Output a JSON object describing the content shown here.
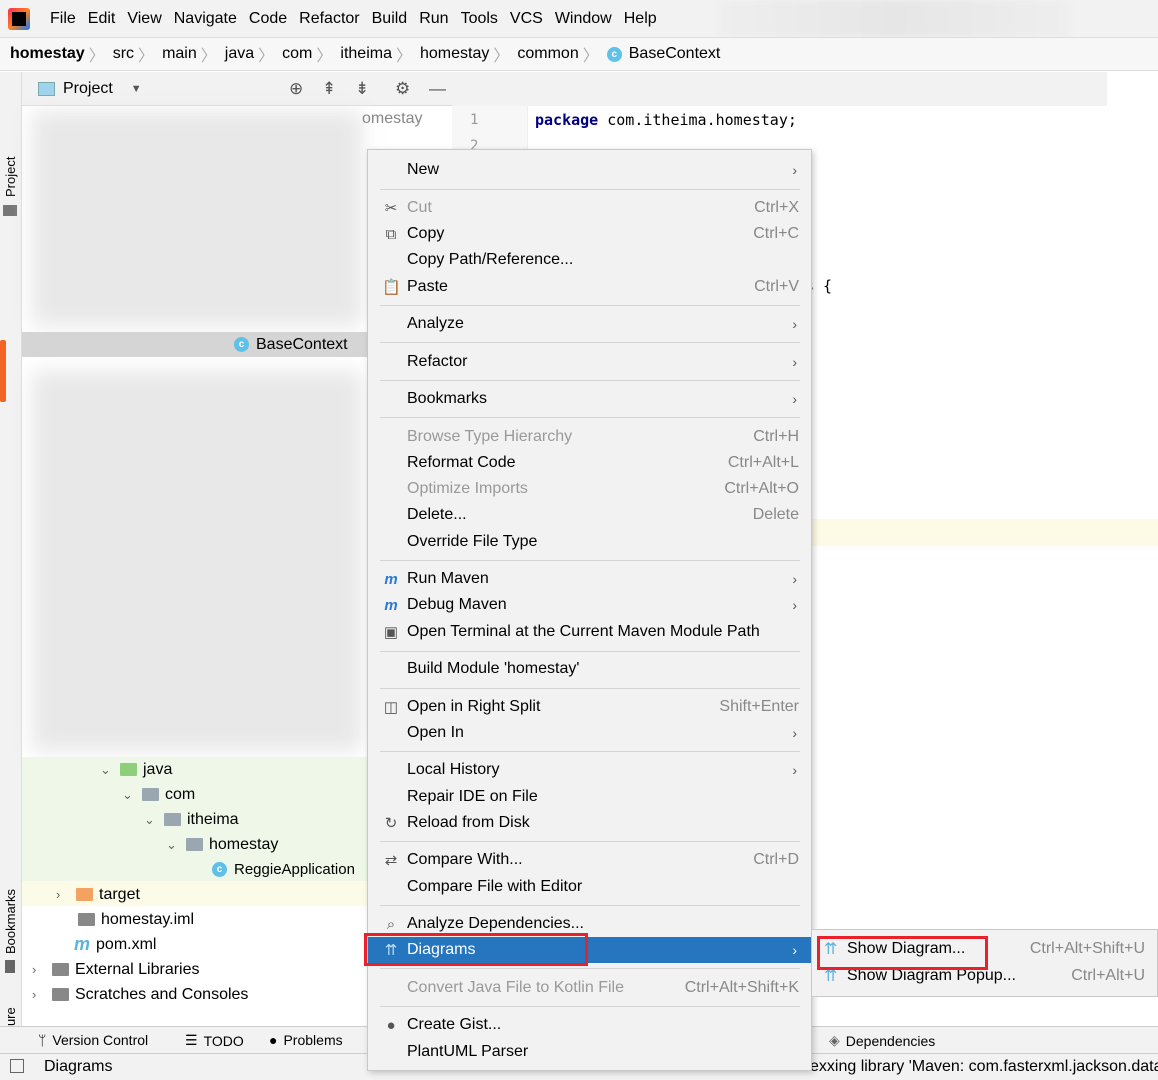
{
  "menubar": {
    "items": [
      "File",
      "Edit",
      "View",
      "Navigate",
      "Code",
      "Refactor",
      "Build",
      "Run",
      "Tools",
      "VCS",
      "Window",
      "Help"
    ]
  },
  "breadcrumb": [
    "homestay",
    "src",
    "main",
    "java",
    "com",
    "itheima",
    "homestay",
    "common",
    "BaseContext"
  ],
  "left_strip": {
    "project": "Project",
    "bookmarks": "Bookmarks",
    "structure": "Structure"
  },
  "project_panel": {
    "title": "Project",
    "partial_label": "omestay"
  },
  "tree": [
    {
      "label": "BaseContext",
      "icon": "class-icon"
    },
    {
      "label": "java",
      "icon": "source-folder-icon"
    },
    {
      "label": "com",
      "icon": "package-icon"
    },
    {
      "label": "itheima",
      "icon": "package-icon"
    },
    {
      "label": "homestay",
      "icon": "package-icon"
    },
    {
      "label": "ReggieApplication",
      "icon": "class-icon"
    },
    {
      "label": "target",
      "icon": "excluded-folder-icon"
    },
    {
      "label": "homestay.iml",
      "icon": "module-file-icon"
    },
    {
      "label": "pom.xml",
      "icon": "maven-icon"
    },
    {
      "label": "External Libraries",
      "icon": "libraries-icon"
    },
    {
      "label": "Scratches and Consoles",
      "icon": "scratches-icon"
    }
  ],
  "editor": {
    "line_numbers": [
      "1",
      "2"
    ],
    "code_keyword": "package",
    "code_rest": " com.itheima.homestay;",
    "brace": "s {"
  },
  "context_menu": [
    {
      "label": "New",
      "submenu": true
    },
    {
      "label": "Cut",
      "shortcut": "Ctrl+X",
      "icon": "scissors-icon",
      "disabled": true
    },
    {
      "label": "Copy",
      "shortcut": "Ctrl+C",
      "icon": "copy-icon"
    },
    {
      "label": "Copy Path/Reference..."
    },
    {
      "label": "Paste",
      "shortcut": "Ctrl+V",
      "icon": "paste-icon"
    },
    {
      "label": "Analyze",
      "submenu": true
    },
    {
      "label": "Refactor",
      "submenu": true
    },
    {
      "label": "Bookmarks",
      "submenu": true
    },
    {
      "label": "Browse Type Hierarchy",
      "shortcut": "Ctrl+H",
      "disabled": true
    },
    {
      "label": "Reformat Code",
      "shortcut": "Ctrl+Alt+L"
    },
    {
      "label": "Optimize Imports",
      "shortcut": "Ctrl+Alt+O",
      "disabled": true
    },
    {
      "label": "Delete...",
      "shortcut": "Delete"
    },
    {
      "label": "Override File Type"
    },
    {
      "label": "Run Maven",
      "submenu": true,
      "icon": "run-maven-icon"
    },
    {
      "label": "Debug Maven",
      "submenu": true,
      "icon": "debug-maven-icon"
    },
    {
      "label": "Open Terminal at the Current Maven Module Path",
      "icon": "terminal-icon"
    },
    {
      "label": "Build Module 'homestay'"
    },
    {
      "label": "Open in Right Split",
      "shortcut": "Shift+Enter",
      "icon": "split-icon"
    },
    {
      "label": "Open In",
      "submenu": true
    },
    {
      "label": "Local History",
      "submenu": true
    },
    {
      "label": "Repair IDE on File"
    },
    {
      "label": "Reload from Disk",
      "icon": "reload-icon"
    },
    {
      "label": "Compare With...",
      "shortcut": "Ctrl+D",
      "icon": "compare-icon"
    },
    {
      "label": "Compare File with Editor"
    },
    {
      "label": "Analyze Dependencies...",
      "icon": "analyze-dependencies-icon"
    },
    {
      "label": "Diagrams",
      "submenu": true,
      "icon": "diagram-icon",
      "selected": true
    },
    {
      "label": "Convert Java File to Kotlin File",
      "shortcut": "Ctrl+Alt+Shift+K",
      "disabled": true
    },
    {
      "label": "Create Gist...",
      "icon": "github-icon"
    },
    {
      "label": "PlantUML Parser"
    }
  ],
  "submenu": [
    {
      "label": "Show Diagram...",
      "shortcut": "Ctrl+Alt+Shift+U"
    },
    {
      "label": "Show Diagram Popup...",
      "shortcut": "Ctrl+Alt+U"
    }
  ],
  "bottom_tools": [
    "Version Control",
    "TODO",
    "Problems",
    "Dependencies"
  ],
  "status": {
    "left": "Diagrams",
    "message": "exxing library 'Maven: com.fasterxml.jackson.data"
  },
  "colors": {
    "selection": "#2675bf",
    "highlight_box": "#e8212a"
  }
}
